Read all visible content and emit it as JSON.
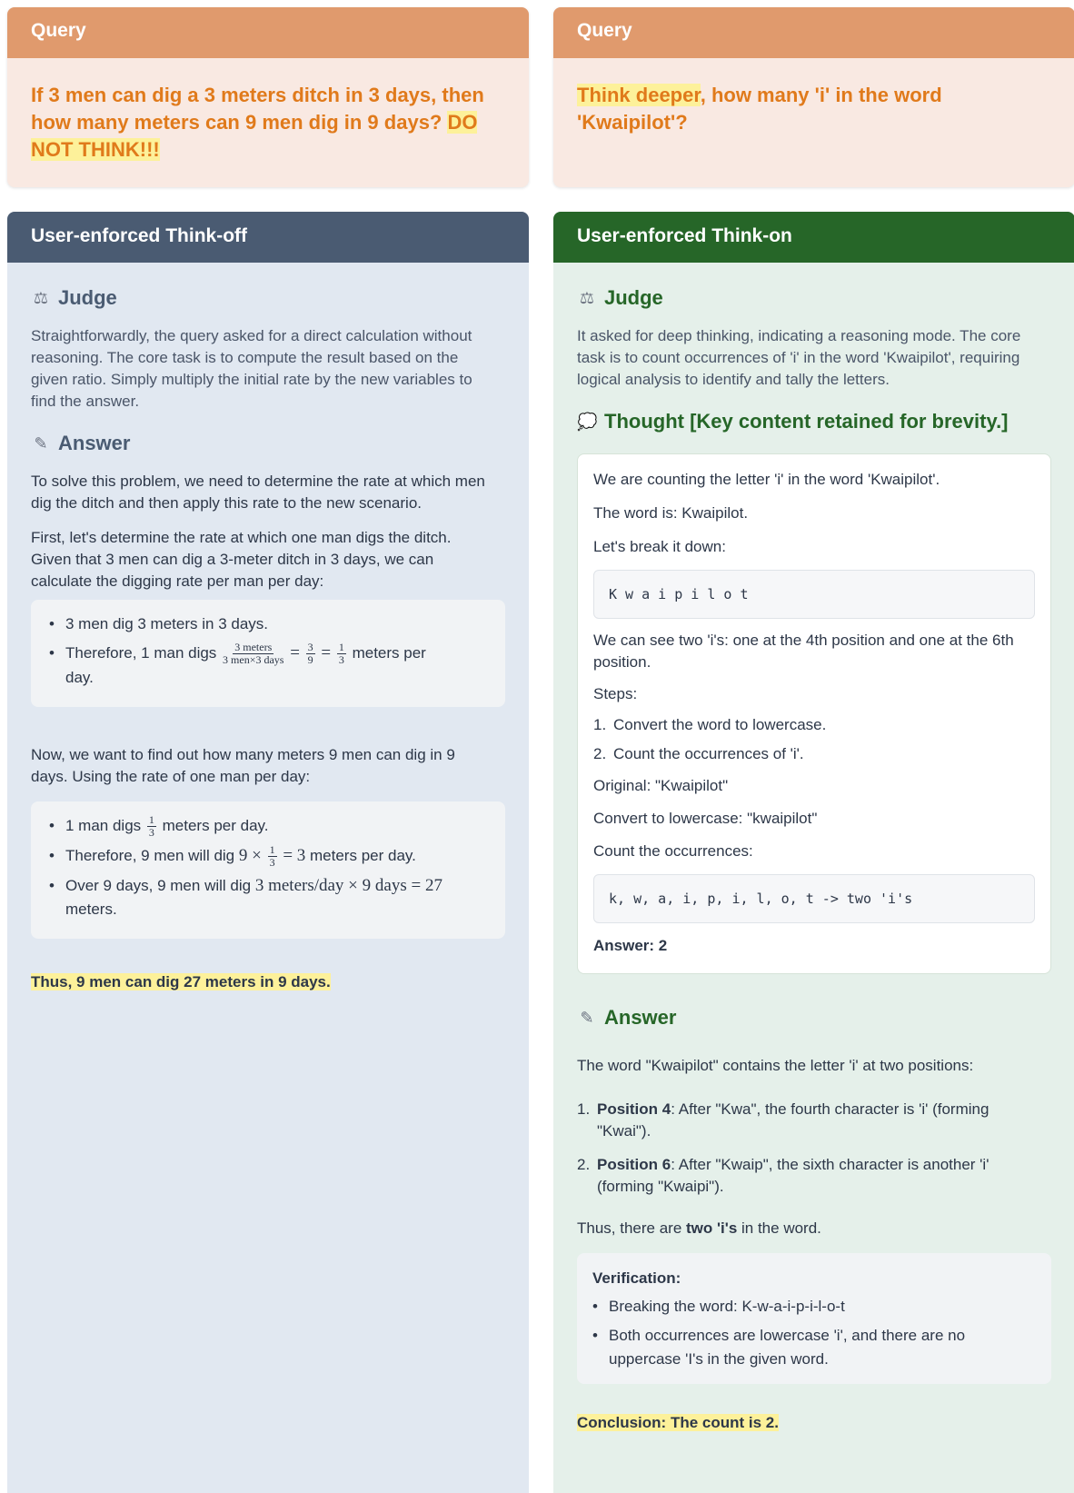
{
  "left": {
    "query": {
      "header": "Query",
      "text_plain": "If 3 men can dig a 3 meters ditch in 3 days, then how many meters can 9 men dig in 9 days? ",
      "text_highlight": "DO NOT THINK!!!"
    },
    "mode_title": "User-enforced Think-off",
    "judge": {
      "title": "Judge",
      "icon": "scales-icon",
      "text": "Straightforwardly, the query asked for a direct calculation without reasoning. The core task is to compute the result based on the given ratio. Simply multiply the initial rate by the new variables to find the answer."
    },
    "answer": {
      "title": "Answer",
      "icon": "memo-icon",
      "p1": "To solve this problem, we need to determine the rate at which men dig the ditch and then apply this rate to the new scenario.",
      "p2": "First, let's determine the rate at which one man digs the ditch. Given that 3 men can dig a 3-meter ditch in 3 days, we can calculate the digging rate per man per day:",
      "box1_item1": "3 men dig 3 meters in 3 days.",
      "box1_item2_prefix": "Therefore, 1 man digs",
      "box1_frac_num": "3 meters",
      "box1_frac_den": "3 men×3 days",
      "box1_eq": "=",
      "box1_f2_num": "3",
      "box1_f2_den": "9",
      "box1_f3_num": "1",
      "box1_f3_den": "3",
      "box1_item2_suffix": "meters per",
      "box1_item2_cont": "day.",
      "p3": "Now, we want to find out how many meters 9 men can dig in 9 days. Using the rate of one man per day:",
      "box2_item1_prefix": "1 man digs",
      "box2_item1_suffix": "meters per day.",
      "box2_item2_prefix": "Therefore, 9 men will dig",
      "box2_item2_math_a": "9 ×",
      "box2_item2_math_b": "= 3",
      "box2_item2_suffix": "meters per day.",
      "box2_item3_prefix": "Over 9 days, 9 men will dig",
      "box2_item3_math": "3 meters/day × 9 days = 27",
      "box2_item3_cont": "meters.",
      "conclusion": "Thus, 9 men can dig 27 meters in 9 days."
    }
  },
  "right": {
    "query": {
      "header": "Query",
      "text_highlight": "Think deeper",
      "text_plain": ", how many 'i' in the word 'Kwaipilot'?"
    },
    "mode_title": "User-enforced Think-on",
    "judge": {
      "title": "Judge",
      "icon": "scales-icon",
      "text": "It asked for deep thinking, indicating a reasoning mode. The core task is to count occurrences of 'i' in the word 'Kwaipilot', requiring logical analysis to identify and tally the letters."
    },
    "thought": {
      "title": "Thought [Key content retained for brevity.]",
      "icon": "thought-bubble-icon",
      "l1": "We are counting the letter 'i' in the word 'Kwaipilot'.",
      "l2": "The word is: Kwaipilot.",
      "l3": "Let's break it down:",
      "code1": "K w a i p i l o t",
      "l4": "We can see two 'i's: one at the 4th position and one at the 6th position.",
      "l5": "Steps:",
      "step1": "Convert the word to lowercase.",
      "step2": "Count the occurrences of 'i'.",
      "l6": "Original: \"Kwaipilot\"",
      "l7": "Convert to lowercase: \"kwaipilot\"",
      "l8": "Count the occurrences:",
      "code2": "k, w, a, i, p, i, l, o, t -> two 'i's",
      "answer_line": "Answer: 2"
    },
    "answer": {
      "title": "Answer",
      "icon": "memo-icon",
      "intro": "The word \"Kwaipilot\" contains the letter 'i' at two positions:",
      "item1_bold": "Position 4",
      "item1_text": ": After \"Kwa\", the fourth character is 'i' (forming \"Kwai\").",
      "item2_bold": "Position 6",
      "item2_text": ": After \"Kwaip\", the sixth character is another 'i' (forming \"Kwaipi\").",
      "summary_prefix": "Thus, there are ",
      "summary_bold": "two 'i's",
      "summary_suffix": " in the word.",
      "verification_title": "Verification:",
      "v1": "Breaking the word: K-w-a-i-p-i-l-o-t",
      "v2": "Both occurrences are lowercase 'i', and there are no uppercase 'I's in the given word.",
      "conclusion_prefix": "Conclusion: The count is ",
      "conclusion_bold": "2."
    }
  }
}
